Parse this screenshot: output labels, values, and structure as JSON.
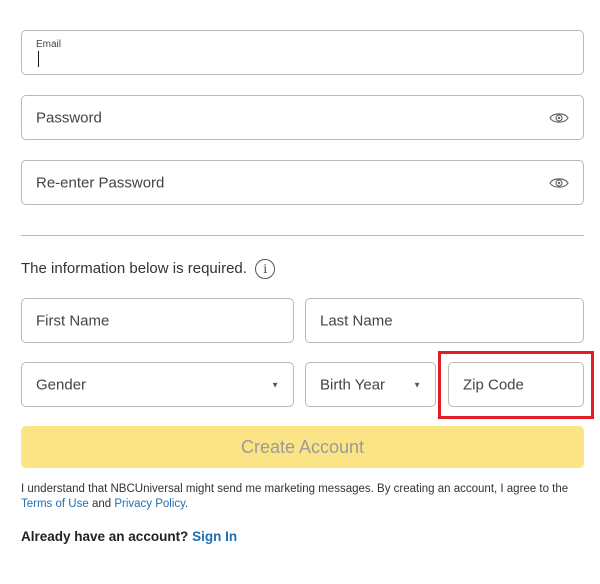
{
  "form": {
    "email": {
      "label": "Email",
      "value": ""
    },
    "password": {
      "placeholder": "Password"
    },
    "reenter_password": {
      "placeholder": "Re-enter Password"
    },
    "required_note": "The information below is required.",
    "first_name": {
      "placeholder": "First Name"
    },
    "last_name": {
      "placeholder": "Last Name"
    },
    "gender": {
      "placeholder": "Gender"
    },
    "birth_year": {
      "placeholder": "Birth Year"
    },
    "zip_code": {
      "placeholder": "Zip Code"
    },
    "create_button": "Create Account"
  },
  "legal": {
    "text_before": "I understand that NBCUniversal might send me marketing messages. By creating an account, I agree to the ",
    "terms_link": "Terms of Use",
    "and": " and ",
    "privacy_link": "Privacy Policy",
    "period": "."
  },
  "signin": {
    "prompt": "Already have an account?",
    "link": "Sign In"
  },
  "icons": {
    "password_toggle": "eye-icon",
    "info": "info-icon",
    "dropdown": "chevron-down-icon"
  },
  "colors": {
    "button_bg": "#fbe486",
    "button_text": "#9a9a9a",
    "link": "#1f6fb2",
    "highlight": "#e01e26",
    "border": "#b9b9b9"
  }
}
